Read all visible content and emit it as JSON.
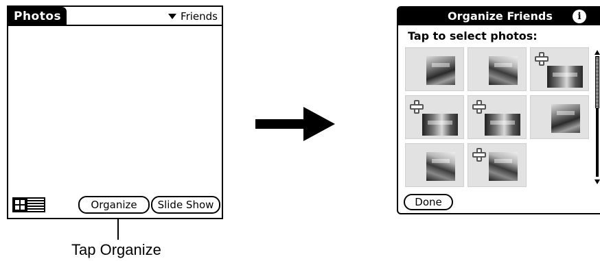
{
  "left_screen": {
    "title": "Photos",
    "category_picker": {
      "selected": "Friends",
      "icon": "dropdown-triangle-icon"
    },
    "view_toggle": {
      "thumbnail_icon": "thumbnail-view-icon",
      "list_icon": "list-view-icon"
    },
    "buttons": {
      "organize": "Organize",
      "slide_show": "Slide Show"
    }
  },
  "callout": {
    "text": "Tap Organize"
  },
  "transition_arrow": {
    "icon": "right-arrow-icon"
  },
  "right_screen": {
    "title": "Organize Friends",
    "info_icon_glyph": "i",
    "prompt": "Tap to select photos:",
    "photos": [
      {
        "has_plus": false,
        "style": "t1",
        "wide": false
      },
      {
        "has_plus": false,
        "style": "t2",
        "wide": false
      },
      {
        "has_plus": true,
        "style": "t3",
        "wide": true
      },
      {
        "has_plus": true,
        "style": "t3",
        "wide": true
      },
      {
        "has_plus": true,
        "style": "t3",
        "wide": true
      },
      {
        "has_plus": false,
        "style": "t1",
        "wide": false
      },
      {
        "has_plus": false,
        "style": "t2",
        "wide": false
      },
      {
        "has_plus": true,
        "style": "t2",
        "wide": false
      },
      {
        "has_plus": false,
        "empty": true
      }
    ],
    "scrollbar": {
      "up_icon": "scroll-up-arrow-icon",
      "down_icon": "scroll-down-arrow-icon"
    },
    "done_button": "Done"
  }
}
